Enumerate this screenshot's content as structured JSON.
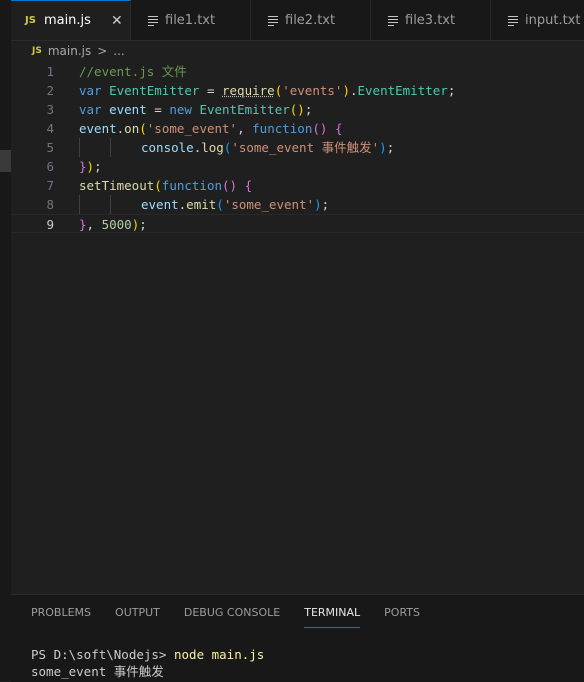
{
  "tabs": [
    {
      "icon": "JS",
      "label": "main.js",
      "close": "✕"
    },
    {
      "label": "file1.txt"
    },
    {
      "label": "file2.txt"
    },
    {
      "label": "file3.txt"
    },
    {
      "label": "input.txt"
    }
  ],
  "breadcrumb": {
    "icon": "JS",
    "file": "main.js",
    "chevron": ">",
    "more": "..."
  },
  "code": {
    "lines": [
      {
        "num": "1",
        "tokens": [
          {
            "t": "//event.js 文件",
            "c": "comment"
          }
        ]
      },
      {
        "num": "2",
        "tokens": [
          {
            "t": "var ",
            "c": "keyword"
          },
          {
            "t": "EventEmitter",
            "c": "class"
          },
          {
            "t": " = ",
            "c": "plain"
          },
          {
            "t": "require",
            "c": "func",
            "u": true
          },
          {
            "t": "(",
            "c": "paren1"
          },
          {
            "t": "'events'",
            "c": "string"
          },
          {
            "t": ")",
            "c": "paren1"
          },
          {
            "t": ".",
            "c": "plain"
          },
          {
            "t": "EventEmitter",
            "c": "class"
          },
          {
            "t": ";",
            "c": "plain"
          }
        ]
      },
      {
        "num": "3",
        "tokens": [
          {
            "t": "var ",
            "c": "keyword"
          },
          {
            "t": "event",
            "c": "var"
          },
          {
            "t": " = ",
            "c": "plain"
          },
          {
            "t": "new ",
            "c": "keyword"
          },
          {
            "t": "EventEmitter",
            "c": "class"
          },
          {
            "t": "()",
            "c": "paren1"
          },
          {
            "t": ";",
            "c": "plain"
          }
        ]
      },
      {
        "num": "4",
        "tokens": [
          {
            "t": "event",
            "c": "var"
          },
          {
            "t": ".",
            "c": "plain"
          },
          {
            "t": "on",
            "c": "func"
          },
          {
            "t": "(",
            "c": "paren1"
          },
          {
            "t": "'some_event'",
            "c": "string"
          },
          {
            "t": ", ",
            "c": "plain"
          },
          {
            "t": "function",
            "c": "keyword"
          },
          {
            "t": "()",
            "c": "paren2"
          },
          {
            "t": " ",
            "c": "plain"
          },
          {
            "t": "{",
            "c": "paren2"
          }
        ]
      },
      {
        "num": "5",
        "indent": 2,
        "tokens": [
          {
            "t": "console",
            "c": "var"
          },
          {
            "t": ".",
            "c": "plain"
          },
          {
            "t": "log",
            "c": "func"
          },
          {
            "t": "(",
            "c": "paren3"
          },
          {
            "t": "'some_event 事件触发'",
            "c": "string"
          },
          {
            "t": ")",
            "c": "paren3"
          },
          {
            "t": ";",
            "c": "plain"
          }
        ]
      },
      {
        "num": "6",
        "tokens": [
          {
            "t": "}",
            "c": "paren2"
          },
          {
            "t": ")",
            "c": "paren1"
          },
          {
            "t": ";",
            "c": "plain"
          }
        ]
      },
      {
        "num": "7",
        "tokens": [
          {
            "t": "setTimeout",
            "c": "func"
          },
          {
            "t": "(",
            "c": "paren1"
          },
          {
            "t": "function",
            "c": "keyword"
          },
          {
            "t": "()",
            "c": "paren2"
          },
          {
            "t": " ",
            "c": "plain"
          },
          {
            "t": "{",
            "c": "paren2"
          }
        ]
      },
      {
        "num": "8",
        "indent": 2,
        "tokens": [
          {
            "t": "event",
            "c": "var"
          },
          {
            "t": ".",
            "c": "plain"
          },
          {
            "t": "emit",
            "c": "func"
          },
          {
            "t": "(",
            "c": "paren3"
          },
          {
            "t": "'some_event'",
            "c": "string"
          },
          {
            "t": ")",
            "c": "paren3"
          },
          {
            "t": ";",
            "c": "plain"
          }
        ]
      },
      {
        "num": "9",
        "current": true,
        "tokens": [
          {
            "t": "}",
            "c": "paren2"
          },
          {
            "t": ", ",
            "c": "plain"
          },
          {
            "t": "5000",
            "c": "num"
          },
          {
            "t": ")",
            "c": "paren1"
          },
          {
            "t": ";",
            "c": "plain"
          }
        ]
      }
    ]
  },
  "panel": {
    "tabs": [
      "PROBLEMS",
      "OUTPUT",
      "DEBUG CONSOLE",
      "TERMINAL",
      "PORTS"
    ],
    "active_tab": "TERMINAL",
    "terminal": {
      "prompt": "PS D:\\soft\\Nodejs> ",
      "command": "node main.js",
      "output": "some_event 事件触发"
    }
  }
}
